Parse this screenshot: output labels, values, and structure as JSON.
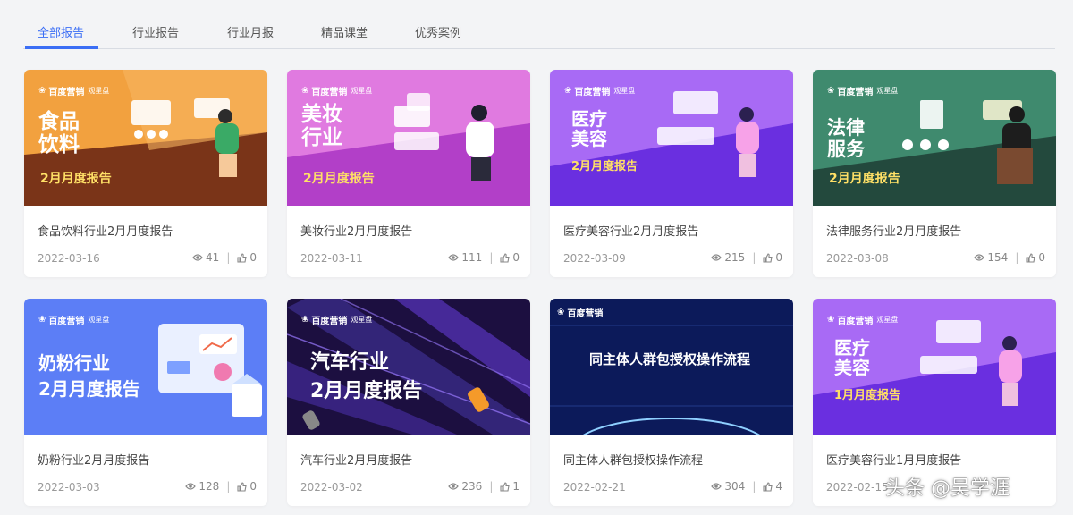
{
  "tabs": [
    "全部报告",
    "行业报告",
    "行业月报",
    "精品课堂",
    "优秀案例"
  ],
  "brand": {
    "name": "百度营销",
    "sub": "观星盘"
  },
  "cards": [
    {
      "title": "食品饮料行业2月月度报告",
      "date": "2022-03-16",
      "views": "41",
      "likes": "0",
      "banner_title_1": "食品",
      "banner_title_2": "饮料",
      "banner_month": "2月月度报告"
    },
    {
      "title": "美妆行业2月月度报告",
      "date": "2022-03-11",
      "views": "111",
      "likes": "0",
      "banner_title_1": "美妆",
      "banner_title_2": "行业",
      "banner_month": "2月月度报告"
    },
    {
      "title": "医疗美容行业2月月度报告",
      "date": "2022-03-09",
      "views": "215",
      "likes": "0",
      "banner_title_1": "医疗",
      "banner_title_2": "美容",
      "banner_month": "2月月度报告"
    },
    {
      "title": "法律服务行业2月月度报告",
      "date": "2022-03-08",
      "views": "154",
      "likes": "0",
      "banner_title_1": "法律",
      "banner_title_2": "服务",
      "banner_month": "2月月度报告"
    },
    {
      "title": "奶粉行业2月月度报告",
      "date": "2022-03-03",
      "views": "128",
      "likes": "0",
      "banner_title_1": "奶粉行业",
      "banner_title_2": "2月月度报告"
    },
    {
      "title": "汽车行业2月月度报告",
      "date": "2022-03-02",
      "views": "236",
      "likes": "1",
      "banner_title_1": "汽车行业",
      "banner_title_2": "2月月度报告"
    },
    {
      "title": "同主体人群包授权操作流程",
      "date": "2022-02-21",
      "views": "304",
      "likes": "4",
      "banner_title_1": "同主体人群包授权操作流程"
    },
    {
      "title": "医疗美容行业1月月度报告",
      "date": "2022-02-15",
      "views": "",
      "likes": "",
      "banner_title_1": "医疗",
      "banner_title_2": "美容",
      "banner_month": "1月月度报告"
    }
  ],
  "watermark": "头条 @吴学涯",
  "colors": {
    "accent": "#3b6ef5",
    "food_bg": "#f0a040",
    "beauty_bg": "#d25fd4",
    "medical_bg": "#8e4df0",
    "law_bg": "#2f6b57",
    "milk_bg": "#5d7ff5",
    "auto_bg": "#24124f",
    "auth_bg": "#102060"
  }
}
